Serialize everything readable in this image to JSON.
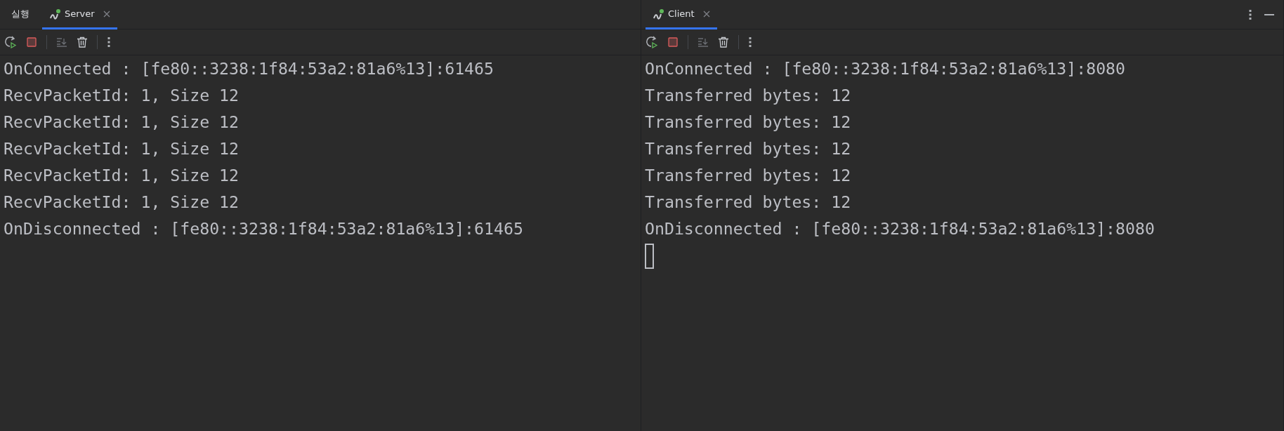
{
  "panes": [
    {
      "tabs": [
        {
          "label": "실행",
          "kind": "title",
          "selected": false
        },
        {
          "label": "Server",
          "kind": "run",
          "selected": true
        }
      ],
      "window_controls": false,
      "console": [
        "OnConnected : [fe80::3238:1f84:53a2:81a6%13]:61465",
        "RecvPacketId: 1, Size 12",
        "RecvPacketId: 1, Size 12",
        "RecvPacketId: 1, Size 12",
        "RecvPacketId: 1, Size 12",
        "RecvPacketId: 1, Size 12",
        "OnDisconnected : [fe80::3238:1f84:53a2:81a6%13]:61465"
      ],
      "input_cursor": false
    },
    {
      "tabs": [
        {
          "label": "Client",
          "kind": "run",
          "selected": true
        }
      ],
      "window_controls": true,
      "console": [
        "OnConnected : [fe80::3238:1f84:53a2:81a6%13]:8080",
        "Transferred bytes: 12",
        "Transferred bytes: 12",
        "Transferred bytes: 12",
        "Transferred bytes: 12",
        "Transferred bytes: 12",
        "OnDisconnected : [fe80::3238:1f84:53a2:81a6%13]:8080"
      ],
      "input_cursor": true
    }
  ]
}
